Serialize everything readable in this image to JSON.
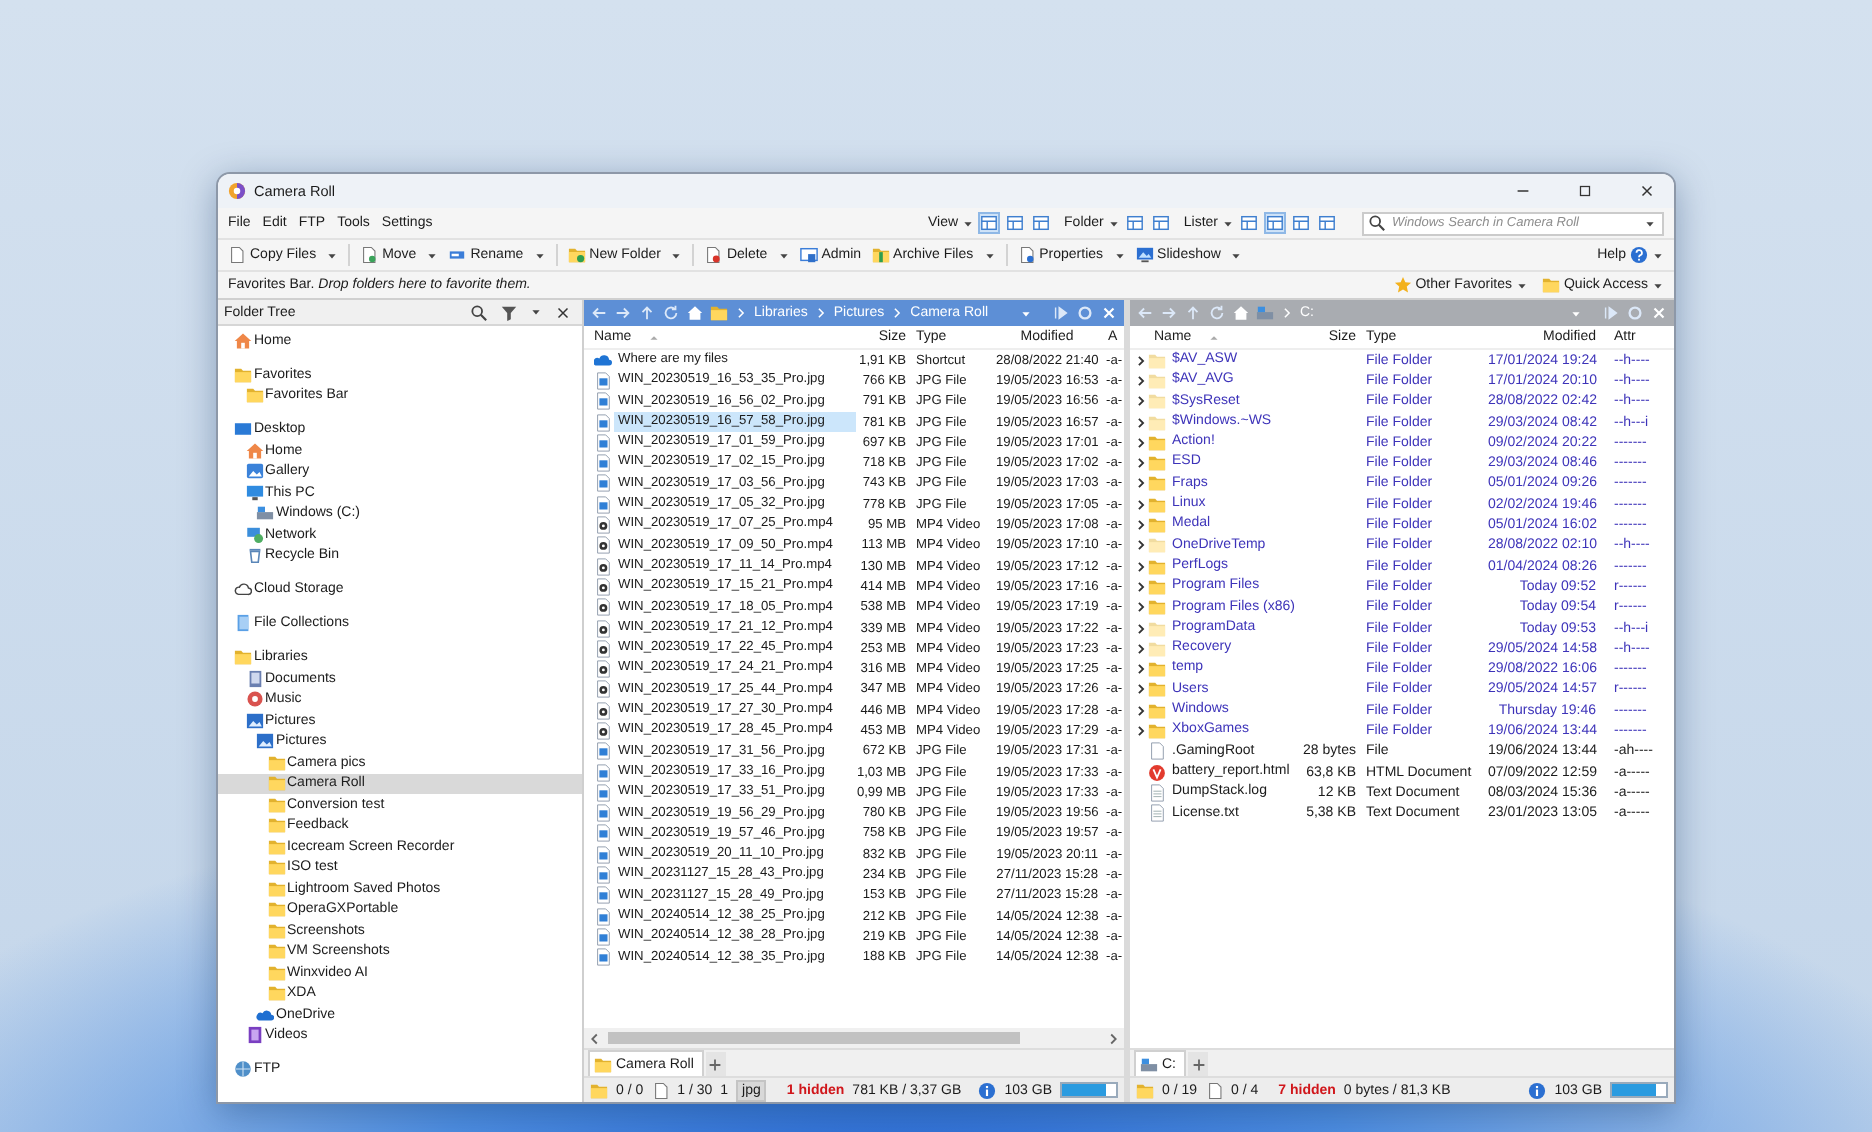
{
  "window": {
    "title": "Camera Roll"
  },
  "menu": [
    "File",
    "Edit",
    "FTP",
    "Tools",
    "Settings"
  ],
  "view_bar": {
    "groups": [
      {
        "label": "View",
        "buttons": [
          {
            "selected": true
          },
          {
            "selected": false
          },
          {
            "selected": false
          }
        ]
      },
      {
        "label": "Folder",
        "buttons": [
          {
            "selected": false
          },
          {
            "selected": false
          }
        ]
      },
      {
        "label": "Lister",
        "buttons": [
          {
            "selected": false
          },
          {
            "selected": true
          },
          {
            "selected": false
          },
          {
            "selected": false
          }
        ]
      }
    ],
    "search": {
      "placeholder": "Windows Search in Camera Roll"
    }
  },
  "toolbar": [
    {
      "label": "Copy Files",
      "dropdown": true
    },
    {
      "label": "Move",
      "dropdown": true
    },
    {
      "label": "Rename",
      "dropdown": true
    },
    {
      "label": "New Folder",
      "dropdown": true
    },
    {
      "label": "Delete",
      "dropdown": true
    },
    {
      "label": "Admin",
      "dropdown": false
    },
    {
      "label": "Archive Files",
      "dropdown": true
    },
    {
      "label": "Properties",
      "dropdown": true
    },
    {
      "label": "Slideshow",
      "dropdown": true
    }
  ],
  "help": "Help",
  "favorites_bar": {
    "text": "Favorites Bar. *Drop folders here to favorite them.*",
    "other_favorites": "Other Favorites",
    "quick_access": "Quick Access"
  },
  "folder_tree": {
    "title": "Folder Tree",
    "items": [
      {
        "label": "Home",
        "kind": "home",
        "selected": false
      },
      {
        "label": "Favorites",
        "kind": "folder",
        "selected": false,
        "children": [
          {
            "label": "Favorites Bar",
            "kind": "folder",
            "selected": false
          }
        ]
      },
      {
        "label": "Desktop",
        "kind": "desktop",
        "selected": false,
        "children": [
          {
            "label": "Home",
            "kind": "home",
            "selected": false
          },
          {
            "label": "Gallery",
            "kind": "gallery",
            "selected": false
          },
          {
            "label": "This PC",
            "kind": "pc",
            "selected": false,
            "children": [
              {
                "label": "Windows (C:)",
                "kind": "drive",
                "selected": false
              }
            ]
          },
          {
            "label": "Network",
            "kind": "network",
            "selected": false
          },
          {
            "label": "Recycle Bin",
            "kind": "recycle",
            "selected": false
          }
        ]
      },
      {
        "label": "Cloud Storage",
        "kind": "cloud",
        "selected": false
      },
      {
        "label": "File Collections",
        "kind": "collections",
        "selected": false
      },
      {
        "label": "Libraries",
        "kind": "folder",
        "selected": false,
        "children": [
          {
            "label": "Documents",
            "kind": "documents",
            "selected": false
          },
          {
            "label": "Music",
            "kind": "music",
            "selected": false
          },
          {
            "label": "Pictures",
            "kind": "pictures",
            "selected": false,
            "children": [
              {
                "label": "Pictures",
                "kind": "pictures",
                "selected": false,
                "children": [
                  {
                    "label": "Camera pics",
                    "kind": "folder",
                    "selected": false
                  },
                  {
                    "label": "Camera Roll",
                    "kind": "folder",
                    "selected": true
                  },
                  {
                    "label": "Conversion test",
                    "kind": "folder",
                    "selected": false
                  },
                  {
                    "label": "Feedback",
                    "kind": "folder",
                    "selected": false
                  },
                  {
                    "label": "Icecream Screen Recorder",
                    "kind": "folder",
                    "selected": false
                  },
                  {
                    "label": "ISO test",
                    "kind": "folder",
                    "selected": false
                  },
                  {
                    "label": "Lightroom Saved Photos",
                    "kind": "folder",
                    "selected": false
                  },
                  {
                    "label": "OperaGXPortable",
                    "kind": "folder",
                    "selected": false
                  },
                  {
                    "label": "Screenshots",
                    "kind": "folder",
                    "selected": false
                  },
                  {
                    "label": "VM Screenshots",
                    "kind": "folder",
                    "selected": false
                  },
                  {
                    "label": "Winxvideo AI",
                    "kind": "folder",
                    "selected": false
                  },
                  {
                    "label": "XDA",
                    "kind": "folder",
                    "selected": false
                  }
                ]
              },
              {
                "label": "OneDrive",
                "kind": "onedrive",
                "selected": false
              }
            ]
          },
          {
            "label": "Videos",
            "kind": "videos",
            "selected": false
          }
        ]
      },
      {
        "label": "FTP",
        "kind": "ftp",
        "selected": false
      }
    ]
  },
  "panes": [
    {
      "active": true,
      "path": [
        "Libraries",
        "Pictures",
        "Camera Roll"
      ],
      "scrollbar": true,
      "columns": [
        {
          "label": "Name",
          "sorted": true
        },
        {
          "label": "Size",
          "sorted": false
        },
        {
          "label": "Type",
          "sorted": false
        },
        {
          "label": "Modified",
          "sorted": false
        },
        {
          "label": "A",
          "sorted": false
        }
      ],
      "rows": [
        {
          "kind": "shortcut",
          "name": "Where are my files",
          "size": "1,91 KB",
          "type": "Shortcut",
          "modified": "28/08/2022 21:40",
          "attr": "-a-",
          "selected": false
        },
        {
          "kind": "image",
          "name": "WIN_20230519_16_53_35_Pro.jpg",
          "size": "766 KB",
          "type": "JPG File",
          "modified": "19/05/2023 16:53",
          "attr": "-a-",
          "selected": false
        },
        {
          "kind": "image",
          "name": "WIN_20230519_16_56_02_Pro.jpg",
          "size": "791 KB",
          "type": "JPG File",
          "modified": "19/05/2023 16:56",
          "attr": "-a-",
          "selected": false
        },
        {
          "kind": "image",
          "name": "WIN_20230519_16_57_58_Pro.jpg",
          "size": "781 KB",
          "type": "JPG File",
          "modified": "19/05/2023 16:57",
          "attr": "-a-",
          "selected": true
        },
        {
          "kind": "image",
          "name": "WIN_20230519_17_01_59_Pro.jpg",
          "size": "697 KB",
          "type": "JPG File",
          "modified": "19/05/2023 17:01",
          "attr": "-a-",
          "selected": false
        },
        {
          "kind": "image",
          "name": "WIN_20230519_17_02_15_Pro.jpg",
          "size": "718 KB",
          "type": "JPG File",
          "modified": "19/05/2023 17:02",
          "attr": "-a-",
          "selected": false
        },
        {
          "kind": "image",
          "name": "WIN_20230519_17_03_56_Pro.jpg",
          "size": "743 KB",
          "type": "JPG File",
          "modified": "19/05/2023 17:03",
          "attr": "-a-",
          "selected": false
        },
        {
          "kind": "image",
          "name": "WIN_20230519_17_05_32_Pro.jpg",
          "size": "778 KB",
          "type": "JPG File",
          "modified": "19/05/2023 17:05",
          "attr": "-a-",
          "selected": false
        },
        {
          "kind": "video",
          "name": "WIN_20230519_17_07_25_Pro.mp4",
          "size": "95 MB",
          "type": "MP4 Video",
          "modified": "19/05/2023 17:08",
          "attr": "-a-",
          "selected": false
        },
        {
          "kind": "video",
          "name": "WIN_20230519_17_09_50_Pro.mp4",
          "size": "113 MB",
          "type": "MP4 Video",
          "modified": "19/05/2023 17:10",
          "attr": "-a-",
          "selected": false
        },
        {
          "kind": "video",
          "name": "WIN_20230519_17_11_14_Pro.mp4",
          "size": "130 MB",
          "type": "MP4 Video",
          "modified": "19/05/2023 17:12",
          "attr": "-a-",
          "selected": false
        },
        {
          "kind": "video",
          "name": "WIN_20230519_17_15_21_Pro.mp4",
          "size": "414 MB",
          "type": "MP4 Video",
          "modified": "19/05/2023 17:16",
          "attr": "-a-",
          "selected": false
        },
        {
          "kind": "video",
          "name": "WIN_20230519_17_18_05_Pro.mp4",
          "size": "538 MB",
          "type": "MP4 Video",
          "modified": "19/05/2023 17:19",
          "attr": "-a-",
          "selected": false
        },
        {
          "kind": "video",
          "name": "WIN_20230519_17_21_12_Pro.mp4",
          "size": "339 MB",
          "type": "MP4 Video",
          "modified": "19/05/2023 17:22",
          "attr": "-a-",
          "selected": false
        },
        {
          "kind": "video",
          "name": "WIN_20230519_17_22_45_Pro.mp4",
          "size": "253 MB",
          "type": "MP4 Video",
          "modified": "19/05/2023 17:23",
          "attr": "-a-",
          "selected": false
        },
        {
          "kind": "video",
          "name": "WIN_20230519_17_24_21_Pro.mp4",
          "size": "316 MB",
          "type": "MP4 Video",
          "modified": "19/05/2023 17:25",
          "attr": "-a-",
          "selected": false
        },
        {
          "kind": "video",
          "name": "WIN_20230519_17_25_44_Pro.mp4",
          "size": "347 MB",
          "type": "MP4 Video",
          "modified": "19/05/2023 17:26",
          "attr": "-a-",
          "selected": false
        },
        {
          "kind": "video",
          "name": "WIN_20230519_17_27_30_Pro.mp4",
          "size": "446 MB",
          "type": "MP4 Video",
          "modified": "19/05/2023 17:28",
          "attr": "-a-",
          "selected": false
        },
        {
          "kind": "video",
          "name": "WIN_20230519_17_28_45_Pro.mp4",
          "size": "453 MB",
          "type": "MP4 Video",
          "modified": "19/05/2023 17:29",
          "attr": "-a-",
          "selected": false
        },
        {
          "kind": "image",
          "name": "WIN_20230519_17_31_56_Pro.jpg",
          "size": "672 KB",
          "type": "JPG File",
          "modified": "19/05/2023 17:31",
          "attr": "-a-",
          "selected": false
        },
        {
          "kind": "image",
          "name": "WIN_20230519_17_33_16_Pro.jpg",
          "size": "1,03 MB",
          "type": "JPG File",
          "modified": "19/05/2023 17:33",
          "attr": "-a-",
          "selected": false
        },
        {
          "kind": "image",
          "name": "WIN_20230519_17_33_51_Pro.jpg",
          "size": "0,99 MB",
          "type": "JPG File",
          "modified": "19/05/2023 17:33",
          "attr": "-a-",
          "selected": false
        },
        {
          "kind": "image",
          "name": "WIN_20230519_19_56_29_Pro.jpg",
          "size": "780 KB",
          "type": "JPG File",
          "modified": "19/05/2023 19:56",
          "attr": "-a-",
          "selected": false
        },
        {
          "kind": "image",
          "name": "WIN_20230519_19_57_46_Pro.jpg",
          "size": "758 KB",
          "type": "JPG File",
          "modified": "19/05/2023 19:57",
          "attr": "-a-",
          "selected": false
        },
        {
          "kind": "image",
          "name": "WIN_20230519_20_11_10_Pro.jpg",
          "size": "832 KB",
          "type": "JPG File",
          "modified": "19/05/2023 20:11",
          "attr": "-a-",
          "selected": false
        },
        {
          "kind": "image",
          "name": "WIN_20231127_15_28_43_Pro.jpg",
          "size": "234 KB",
          "type": "JPG File",
          "modified": "27/11/2023 15:28",
          "attr": "-a-",
          "selected": false
        },
        {
          "kind": "image",
          "name": "WIN_20231127_15_28_49_Pro.jpg",
          "size": "153 KB",
          "type": "JPG File",
          "modified": "27/11/2023 15:28",
          "attr": "-a-",
          "selected": false
        },
        {
          "kind": "image",
          "name": "WIN_20240514_12_38_25_Pro.jpg",
          "size": "212 KB",
          "type": "JPG File",
          "modified": "14/05/2024 12:38",
          "attr": "-a-",
          "selected": false
        },
        {
          "kind": "image",
          "name": "WIN_20240514_12_38_28_Pro.jpg",
          "size": "219 KB",
          "type": "JPG File",
          "modified": "14/05/2024 12:38",
          "attr": "-a-",
          "selected": false
        },
        {
          "kind": "image",
          "name": "WIN_20240514_12_38_35_Pro.jpg",
          "size": "188 KB",
          "type": "JPG File",
          "modified": "14/05/2024 12:38",
          "attr": "-a-",
          "selected": false
        }
      ],
      "tabs": [
        {
          "label": "Camera Roll",
          "kind": "folder",
          "selected": true
        }
      ],
      "status": {
        "folders": "0 / 0",
        "files": "1 / 30",
        "filter_count": "1",
        "filter": "jpg",
        "hidden": "1 hidden",
        "selection": "781 KB / 3,37 GB",
        "disk": {
          "free": "103 GB",
          "level": 0.8
        }
      }
    },
    {
      "active": false,
      "path": [
        "C:"
      ],
      "scrollbar": false,
      "columns": [
        {
          "label": "Name",
          "sorted": true
        },
        {
          "label": "Size",
          "sorted": false
        },
        {
          "label": "Type",
          "sorted": false
        },
        {
          "label": "Modified",
          "sorted": false
        },
        {
          "label": "Attr",
          "sorted": false
        }
      ],
      "rows": [
        {
          "kind": "folder",
          "name": "$AV_ASW",
          "type": "File Folder",
          "modified": "17/01/2024 19:24",
          "attr": "--h----",
          "hidden": true,
          "selected": false
        },
        {
          "kind": "folder",
          "name": "$AV_AVG",
          "type": "File Folder",
          "modified": "17/01/2024 20:10",
          "attr": "--h----",
          "hidden": true,
          "selected": false
        },
        {
          "kind": "folder",
          "name": "$SysReset",
          "type": "File Folder",
          "modified": "28/08/2022 02:42",
          "attr": "--h----",
          "hidden": true,
          "selected": false
        },
        {
          "kind": "folder",
          "name": "$Windows.~WS",
          "type": "File Folder",
          "modified": "29/03/2024 08:42",
          "attr": "--h---i",
          "hidden": true,
          "selected": false
        },
        {
          "kind": "folder",
          "name": "Action!",
          "type": "File Folder",
          "modified": "09/02/2024 20:22",
          "attr": "-------",
          "hidden": false,
          "selected": false
        },
        {
          "kind": "folder",
          "name": "ESD",
          "type": "File Folder",
          "modified": "29/03/2024 08:46",
          "attr": "-------",
          "hidden": false,
          "selected": false
        },
        {
          "kind": "folder",
          "name": "Fraps",
          "type": "File Folder",
          "modified": "05/01/2024 09:26",
          "attr": "-------",
          "hidden": false,
          "selected": false
        },
        {
          "kind": "folder",
          "name": "Linux",
          "type": "File Folder",
          "modified": "02/02/2024 19:46",
          "attr": "-------",
          "hidden": false,
          "selected": false
        },
        {
          "kind": "folder",
          "name": "Medal",
          "type": "File Folder",
          "modified": "05/01/2024 16:02",
          "attr": "-------",
          "hidden": false,
          "selected": false
        },
        {
          "kind": "folder",
          "name": "OneDriveTemp",
          "type": "File Folder",
          "modified": "28/08/2022 02:10",
          "attr": "--h----",
          "hidden": true,
          "selected": false
        },
        {
          "kind": "folder",
          "name": "PerfLogs",
          "type": "File Folder",
          "modified": "01/04/2024 08:26",
          "attr": "-------",
          "hidden": false,
          "selected": false
        },
        {
          "kind": "folder",
          "name": "Program Files",
          "type": "File Folder",
          "modified": "Today 09:52",
          "attr": "r------",
          "hidden": false,
          "selected": false
        },
        {
          "kind": "folder",
          "name": "Program Files (x86)",
          "type": "File Folder",
          "modified": "Today 09:54",
          "attr": "r------",
          "hidden": false,
          "selected": false
        },
        {
          "kind": "folder",
          "name": "ProgramData",
          "type": "File Folder",
          "modified": "Today 09:53",
          "attr": "--h---i",
          "hidden": true,
          "selected": false
        },
        {
          "kind": "folder",
          "name": "Recovery",
          "type": "File Folder",
          "modified": "29/05/2024 14:58",
          "attr": "--h----",
          "hidden": true,
          "selected": false
        },
        {
          "kind": "folder",
          "name": "temp",
          "type": "File Folder",
          "modified": "29/08/2022 16:06",
          "attr": "-------",
          "hidden": false,
          "selected": false
        },
        {
          "kind": "folder",
          "name": "Users",
          "type": "File Folder",
          "modified": "29/05/2024 14:57",
          "attr": "r------",
          "hidden": false,
          "selected": false
        },
        {
          "kind": "folder",
          "name": "Windows",
          "type": "File Folder",
          "modified": "Thursday 19:46",
          "attr": "-------",
          "hidden": false,
          "selected": false
        },
        {
          "kind": "folder",
          "name": "XboxGames",
          "type": "File Folder",
          "modified": "19/06/2024 13:44",
          "attr": "-------",
          "hidden": false,
          "selected": false
        },
        {
          "kind": "file",
          "name": ".GamingRoot",
          "size": "28 bytes",
          "type": "File",
          "modified": "19/06/2024 13:44",
          "attr": "-ah----",
          "hidden": false,
          "selected": false
        },
        {
          "kind": "html",
          "name": "battery_report.html",
          "size": "63,8 KB",
          "type": "HTML Document",
          "modified": "07/09/2022 12:59",
          "attr": "-a-----",
          "hidden": false,
          "selected": false
        },
        {
          "kind": "text",
          "name": "DumpStack.log",
          "size": "12 KB",
          "type": "Text Document",
          "modified": "08/03/2024 15:36",
          "attr": "-a-----",
          "hidden": false,
          "selected": false
        },
        {
          "kind": "text",
          "name": "License.txt",
          "size": "5,38 KB",
          "type": "Text Document",
          "modified": "23/01/2023 13:05",
          "attr": "-a-----",
          "hidden": false,
          "selected": false
        }
      ],
      "tabs": [
        {
          "label": "C:",
          "kind": "drive",
          "selected": true
        }
      ],
      "status": {
        "folders": "0 / 19",
        "files": "0 / 4",
        "hidden": "7 hidden",
        "selection": "0 bytes / 81,3 KB",
        "disk": {
          "free": "103 GB",
          "level": 0.8
        }
      }
    }
  ]
}
